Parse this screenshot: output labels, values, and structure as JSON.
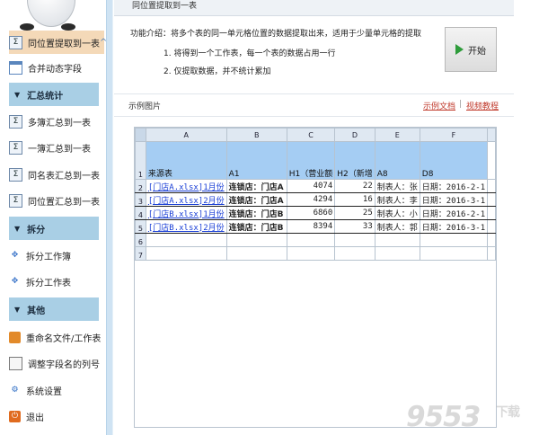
{
  "sidebar": {
    "items": [
      {
        "label": "同位置提取到一表",
        "icon": "sigma-icon",
        "active": true
      },
      {
        "label": "合并动态字段",
        "icon": "table-icon"
      }
    ],
    "sections": [
      {
        "title": "汇总统计",
        "items": [
          {
            "label": "多簿汇总到一表",
            "icon": "sigma-icon"
          },
          {
            "label": "一簿汇总到一表",
            "icon": "sigma-icon"
          },
          {
            "label": "同名表汇总到一表",
            "icon": "sigma-icon"
          },
          {
            "label": "同位置汇总到一表",
            "icon": "sigma-icon"
          }
        ]
      },
      {
        "title": "拆分",
        "items": [
          {
            "label": "拆分工作簿",
            "icon": "puzzle-icon"
          },
          {
            "label": "拆分工作表",
            "icon": "puzzle-icon"
          }
        ]
      },
      {
        "title": "其他",
        "items": [
          {
            "label": "重命名文件/工作表",
            "icon": "rename-icon"
          },
          {
            "label": "调整字段名的列号",
            "icon": "document-icon"
          },
          {
            "label": "系统设置",
            "icon": "gear-icon"
          },
          {
            "label": "退出",
            "icon": "exit-icon"
          }
        ]
      }
    ]
  },
  "header": {
    "title": "同位置提取到一表"
  },
  "intro": {
    "text": "功能介绍：将多个表的同一单元格位置的数据提取出来，适用于少量单元格的提取",
    "step1": "1. 将得到一个工作表，每一个表的数据占用一行",
    "step2": "2. 仅提取数据，并不统计累加"
  },
  "start_button": {
    "label": "开始"
  },
  "example": {
    "title": "示例图片",
    "link_doc": "示例文档",
    "separator": "|",
    "link_video": "视频教程"
  },
  "sheet": {
    "columns": [
      "A",
      "B",
      "C",
      "D",
      "E",
      "F"
    ],
    "header_row": {
      "row": "1",
      "cells": [
        "来源表",
        "A1",
        "H1（营业额",
        "H2（新增",
        "A8",
        "D8"
      ]
    },
    "rows": [
      {
        "row": "2",
        "cells": [
          "[门店A.xlsx]1月份",
          "连锁店：门店A",
          "4074",
          "22",
          "制表人：张",
          "日期：2016-2-1"
        ]
      },
      {
        "row": "3",
        "cells": [
          "[门店A.xlsx]2月份",
          "连锁店：门店A",
          "4294",
          "16",
          "制表人：李",
          "日期：2016-3-1"
        ]
      },
      {
        "row": "4",
        "cells": [
          "[门店B.xlsx]1月份",
          "连锁店：门店B",
          "6860",
          "25",
          "制表人：小",
          "日期：2016-2-1"
        ]
      },
      {
        "row": "5",
        "cells": [
          "[门店B.xlsx]2月份",
          "连锁店：门店B",
          "8394",
          "33",
          "制表人：郭",
          "日期：2016-3-1"
        ]
      }
    ],
    "empty_rows": [
      "6",
      "7"
    ]
  },
  "watermark": {
    "text": "9553",
    "sub": "下载"
  }
}
